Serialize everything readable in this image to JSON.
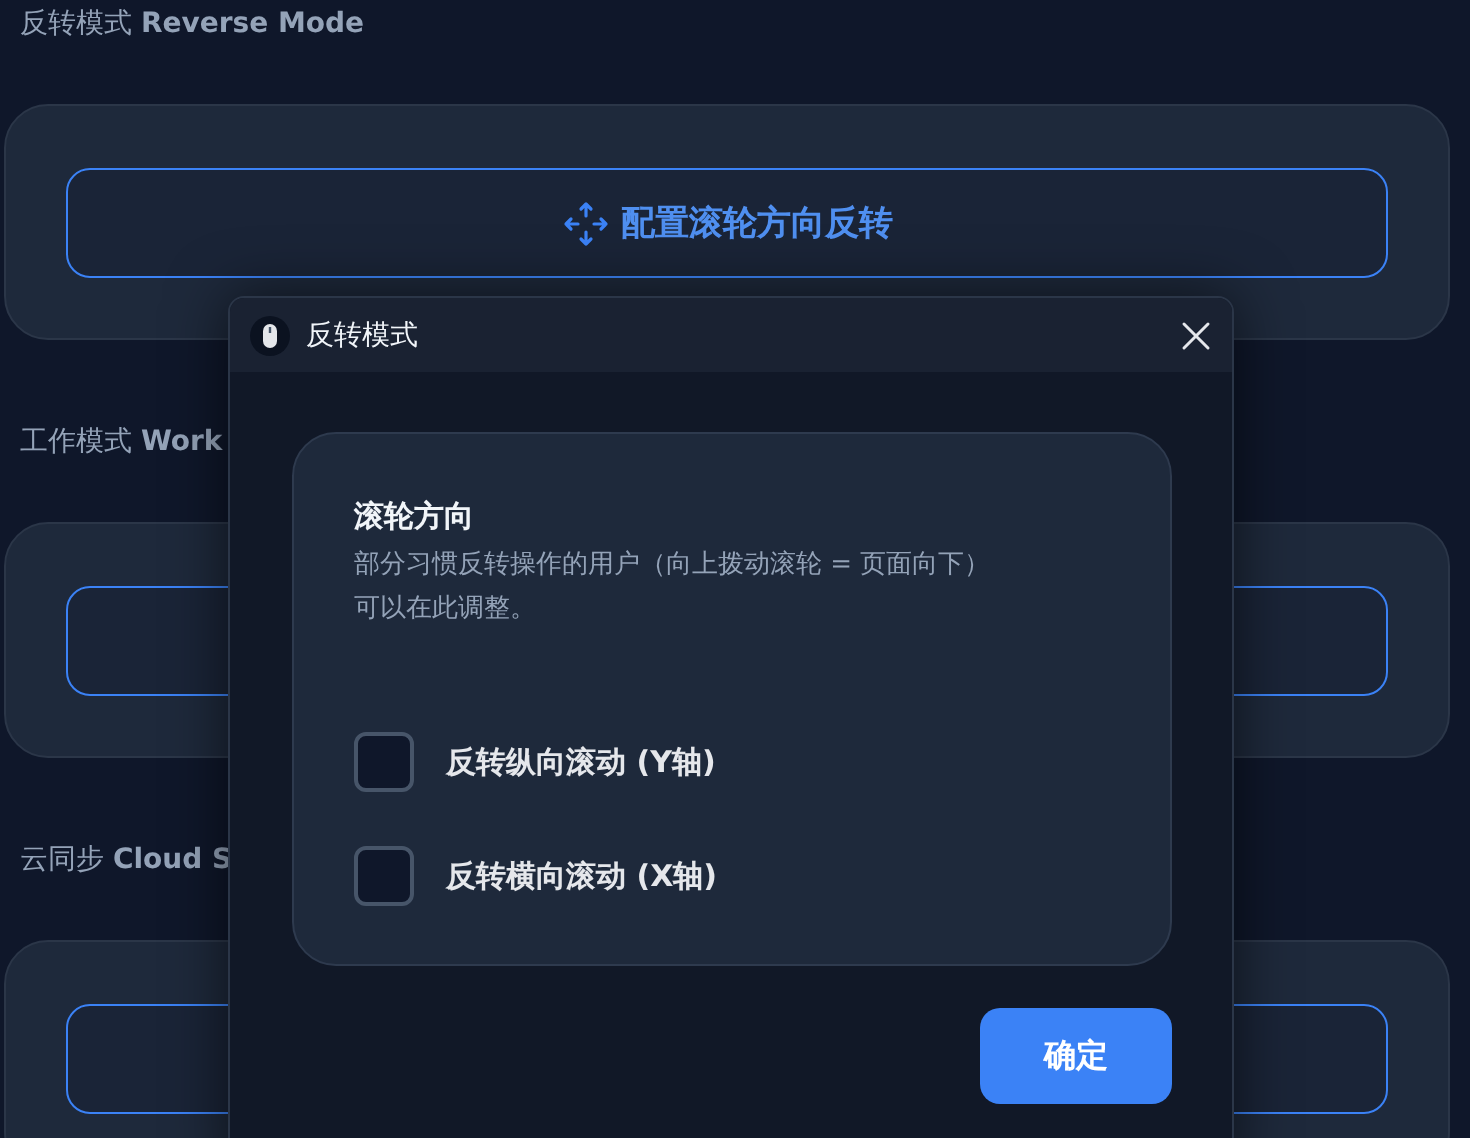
{
  "sections": [
    {
      "heading": "反转模式 **Reverse Mode**",
      "button": {
        "label": "配置滚轮方向反转"
      }
    },
    {
      "heading": "工作模式 **Work**"
    },
    {
      "heading": "云同步 **Cloud S**"
    }
  ],
  "dialog": {
    "title": "反转模式",
    "group": {
      "title": "滚轮方向",
      "description": "部分习惯反转操作的用户（向上拨动滚轮 = 页面向下）可以在此调整。",
      "options": [
        {
          "label": "反转纵向滚动 (Y轴)",
          "checked": false
        },
        {
          "label": "反转横向滚动 (X轴)",
          "checked": false
        }
      ]
    },
    "confirm": "确定"
  }
}
